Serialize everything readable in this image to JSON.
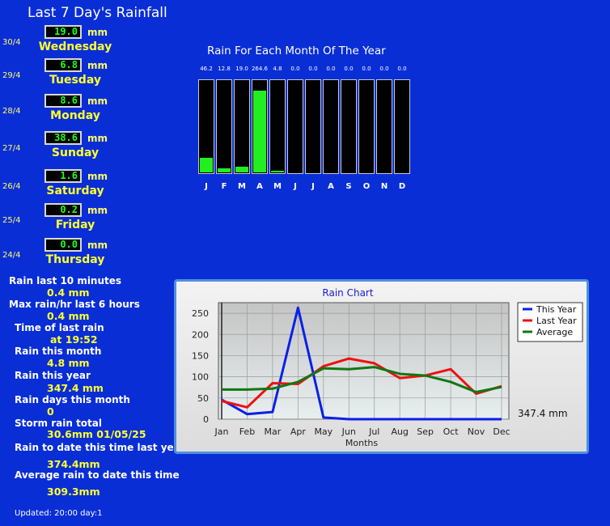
{
  "page_title": "Last 7 Day's Rainfall",
  "rain_unit": "mm",
  "days": [
    {
      "date": "30/4",
      "value": "19.0",
      "name": "Wednesday"
    },
    {
      "date": "29/4",
      "value": "6.8",
      "name": "Tuesday"
    },
    {
      "date": "28/4",
      "value": "8.6",
      "name": "Monday"
    },
    {
      "date": "27/4",
      "value": "38.6",
      "name": "Sunday"
    },
    {
      "date": "26/4",
      "value": "1.6",
      "name": "Saturday"
    },
    {
      "date": "25/4",
      "value": "0.2",
      "name": "Friday"
    },
    {
      "date": "24/4",
      "value": "0.0",
      "name": "Thursday"
    }
  ],
  "stats": [
    {
      "label": "Rain last 10 minutes",
      "value": "0.4 mm"
    },
    {
      "label": "Max rain/hr last 6 hours",
      "value": "0.4 mm"
    },
    {
      "label": "Time of last rain",
      "value": "at 19:52"
    },
    {
      "label": "Rain this month",
      "value": "4.8 mm"
    },
    {
      "label": "Rain this year",
      "value": "347.4 mm"
    },
    {
      "label": "Rain days this month",
      "value": "0"
    },
    {
      "label": "Storm rain total",
      "value": "30.6mm 01/05/25"
    },
    {
      "label": "Rain to date this time last year",
      "value": "374.4mm"
    },
    {
      "label": "Average rain to date this time",
      "value": "309.3mm"
    }
  ],
  "updated": "Updated: 20:00 day:1",
  "chart_data": [
    {
      "type": "bar",
      "title": "Rain For Each Month Of The Year",
      "categories": [
        "J",
        "F",
        "M",
        "A",
        "M",
        "J",
        "J",
        "A",
        "S",
        "O",
        "N",
        "D"
      ],
      "value_labels": [
        "46.2",
        "12.8",
        "19.0",
        "264.6",
        "4.8",
        "0.0",
        "0.0",
        "0.0",
        "0.0",
        "0.0",
        "0.0",
        "0.0"
      ],
      "values": [
        46.2,
        12.8,
        19.0,
        264.6,
        4.8,
        0,
        0,
        0,
        0,
        0,
        0,
        0
      ],
      "ylim": [
        0,
        300
      ],
      "colors": {
        "fill": "#22ee22",
        "background": "#000000"
      }
    },
    {
      "type": "line",
      "title": "Rain Chart",
      "xlabel": "Months",
      "ylabel": "",
      "categories": [
        "Jan",
        "Feb",
        "Mar",
        "Apr",
        "May",
        "Jun",
        "Jul",
        "Aug",
        "Sep",
        "Oct",
        "Nov",
        "Dec"
      ],
      "ylim": [
        0,
        275
      ],
      "yticks": [
        0,
        50,
        100,
        150,
        200,
        250
      ],
      "grid": true,
      "legend": "top-right",
      "side_label": "347.4 mm",
      "series": [
        {
          "name": "This Year",
          "color": "#0b1fe8",
          "values": [
            46,
            12,
            17,
            263,
            4,
            0,
            0,
            0,
            0,
            0,
            0,
            0
          ]
        },
        {
          "name": "Last Year",
          "color": "#ee1111",
          "values": [
            43,
            28,
            85,
            83,
            125,
            143,
            132,
            97,
            103,
            118,
            60,
            78
          ]
        },
        {
          "name": "Average",
          "color": "#117711",
          "values": [
            70,
            70,
            72,
            88,
            120,
            118,
            123,
            107,
            103,
            88,
            64,
            76
          ]
        }
      ]
    }
  ]
}
